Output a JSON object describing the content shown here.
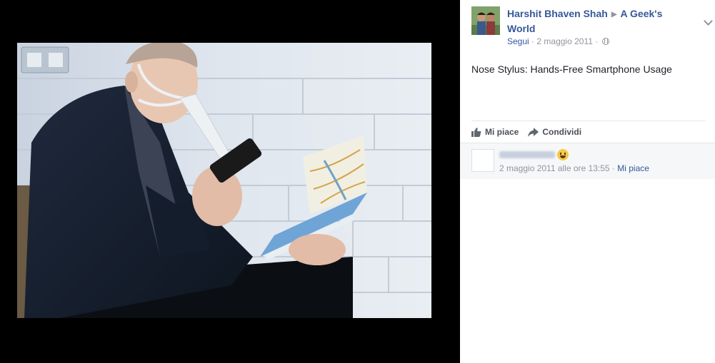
{
  "post": {
    "author": "Harshit Bhaven Shah",
    "page": "A Geek's World",
    "follow_label": "Segui",
    "date": "2 maggio 2011",
    "separator": "·",
    "text": "Nose Stylus: Hands-Free Smartphone Usage",
    "privacy_icon": "globe-icon"
  },
  "actions": {
    "like_label": "Mi piace",
    "share_label": "Condividi"
  },
  "comment": {
    "timestamp": "2 maggio 2011 alle ore 13:55",
    "separator": "·",
    "like_label": "Mi piace",
    "emoji_icon": "grinning-emoji-icon"
  },
  "colors": {
    "link": "#365899",
    "meta": "#90949c",
    "text": "#1d2129",
    "viewer_bg": "#000000",
    "comments_bg": "#f6f7f9"
  }
}
